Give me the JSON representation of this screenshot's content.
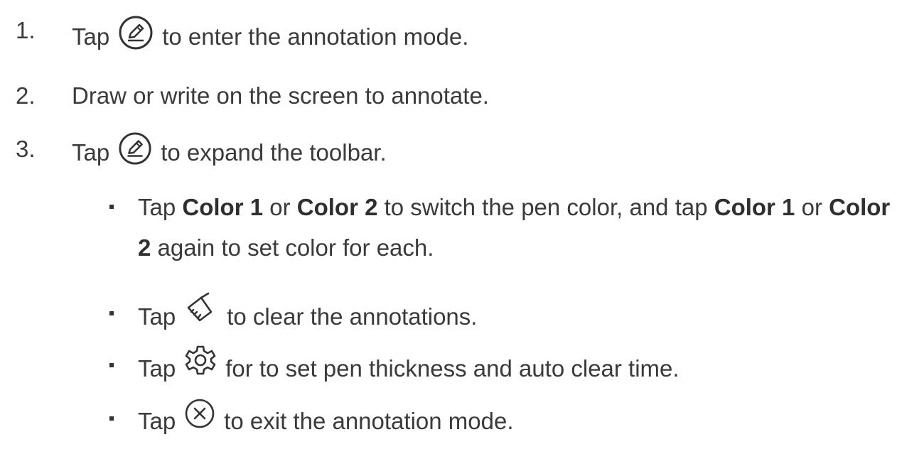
{
  "steps": [
    {
      "num": "1.",
      "pre": "Tap",
      "icon": "pen-circle-icon",
      "post": "to enter the annotation mode."
    },
    {
      "num": "2.",
      "text": "Draw or write on the screen to annotate."
    },
    {
      "num": "3.",
      "pre": "Tap",
      "icon": "pen-circle-icon",
      "post": "to expand the toolbar."
    }
  ],
  "sub": {
    "color_para": {
      "t1": "Tap ",
      "b1": "Color 1",
      "t2": " or ",
      "b2": "Color 2",
      "t3": " to switch the pen color, and tap ",
      "b3": "Color 1",
      "t4": " or ",
      "b4": "Color",
      "b5": "2",
      "t5": " again to set color for each."
    },
    "clear": {
      "pre": "Tap",
      "icon": "broom-icon",
      "post": "to clear the annotations."
    },
    "settings": {
      "pre": "Tap",
      "icon": "gear-icon",
      "post": "for to set pen thickness and auto clear time."
    },
    "exit": {
      "pre": "Tap",
      "icon": "close-circle-icon",
      "post": "to exit the annotation mode."
    }
  },
  "colors": {
    "text": "#3a3a3a",
    "icon": "#333333"
  }
}
